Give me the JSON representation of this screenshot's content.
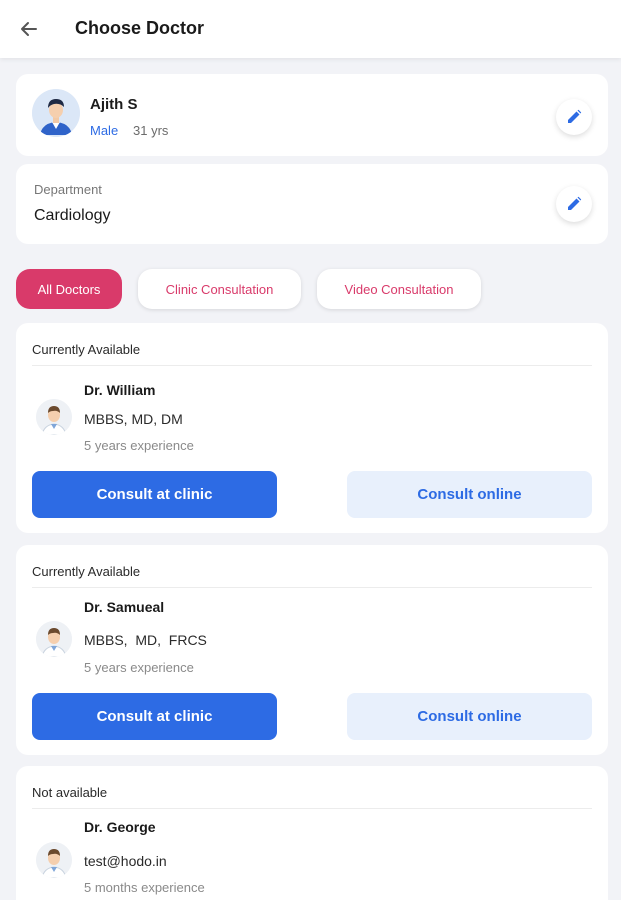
{
  "header": {
    "title": "Choose Doctor",
    "back_icon": "arrow-left-icon"
  },
  "patient": {
    "name": "Ajith S",
    "gender": "Male",
    "age": "31 yrs"
  },
  "department": {
    "label": "Department",
    "value": "Cardiology"
  },
  "filters": [
    {
      "label": "All Doctors",
      "active": true
    },
    {
      "label": "Clinic Consultation",
      "active": false
    },
    {
      "label": "Video Consultation",
      "active": false
    }
  ],
  "doctors": [
    {
      "availability": "Currently Available",
      "name": "Dr. William",
      "qualification": "MBBS, MD, DM",
      "experience": "5 years experience",
      "clinic_label": "Consult at clinic",
      "online_label": "Consult online"
    },
    {
      "availability": "Currently Available",
      "name": "Dr. Samueal",
      "qualification": "MBBS,  MD,  FRCS",
      "experience": "5 years experience",
      "clinic_label": "Consult at clinic",
      "online_label": "Consult online"
    },
    {
      "availability": "Not available",
      "name": "Dr. George",
      "qualification": "test@hodo.in",
      "experience": "5 months experience"
    }
  ],
  "colors": {
    "accent_pink": "#d93a6a",
    "primary_blue": "#2d6be4",
    "light_blue": "#e8f0fc",
    "background": "#f2f3f7"
  }
}
